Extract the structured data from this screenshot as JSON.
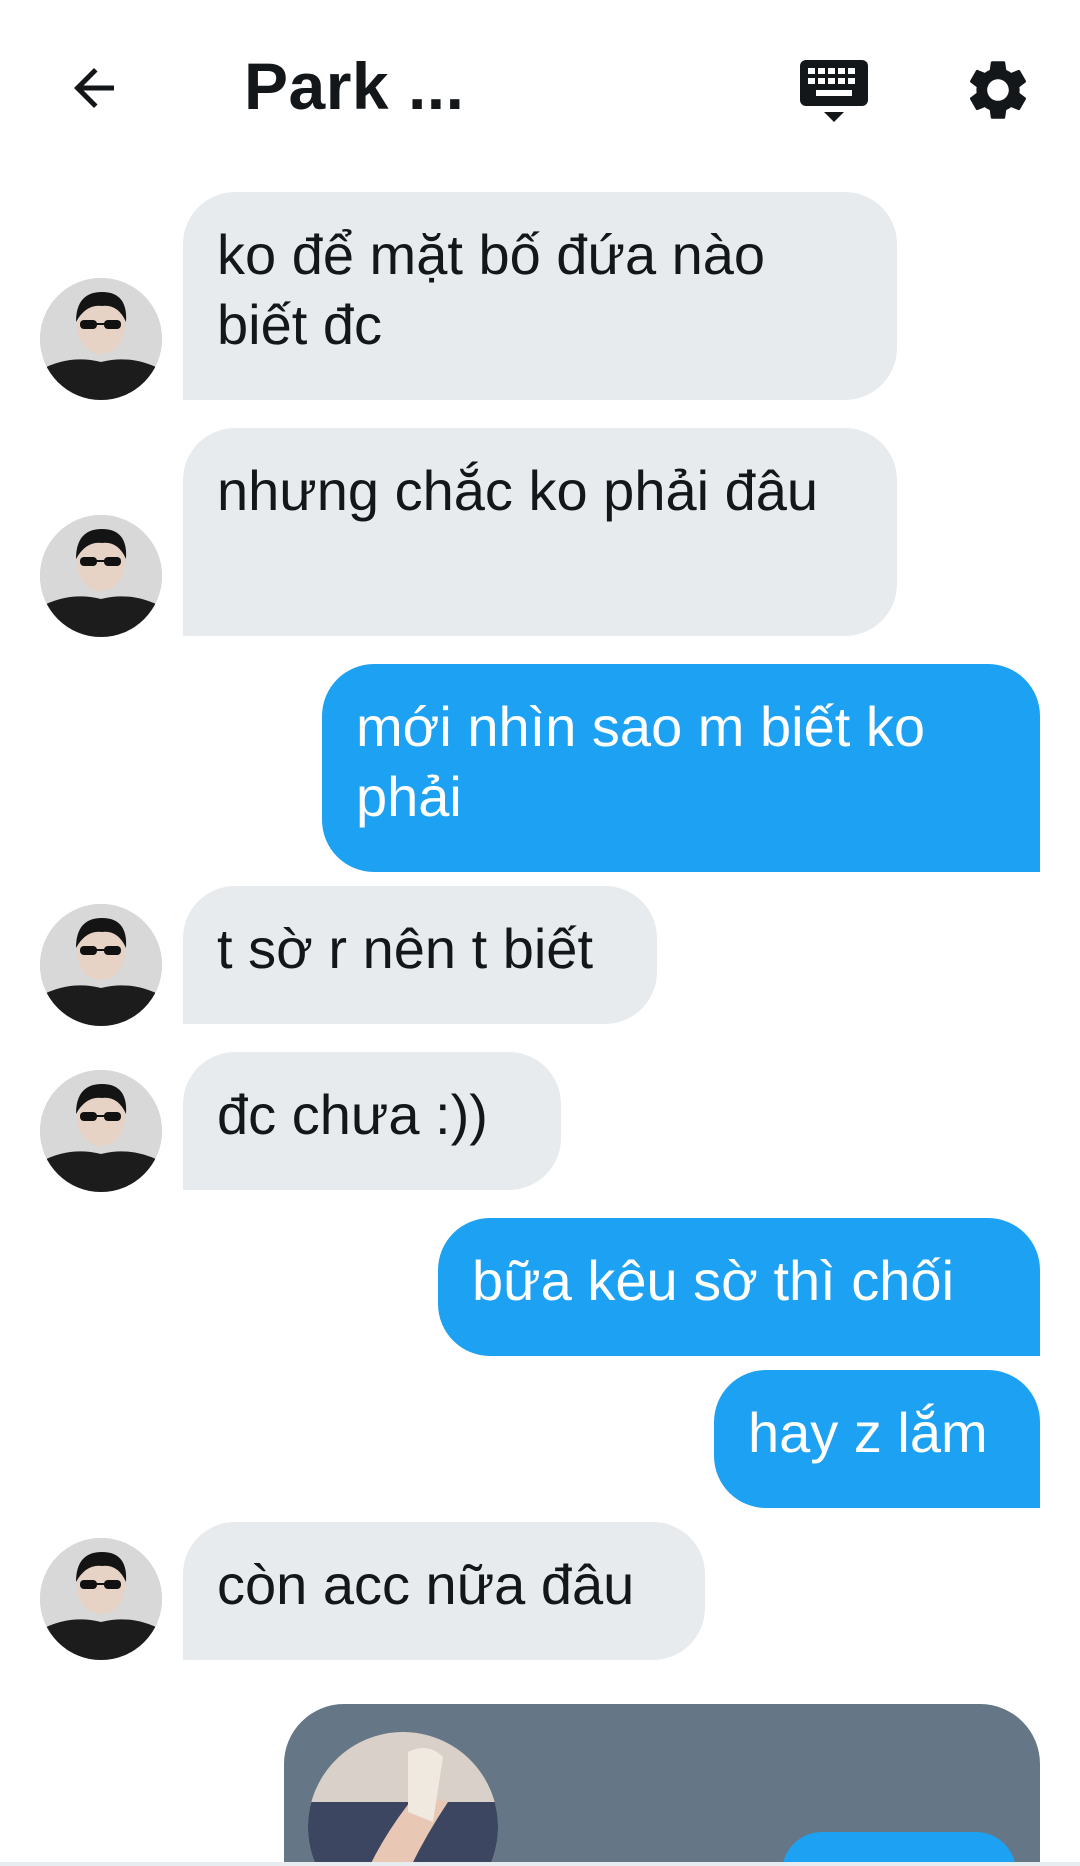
{
  "header": {
    "title": "Park ...",
    "back_icon": "arrow-left-icon",
    "keyboard_icon": "keyboard-icon",
    "settings_icon": "gear-icon"
  },
  "messages": [
    {
      "direction": "incoming",
      "text": "ko để mặt bố đứa nào biết đc"
    },
    {
      "direction": "incoming",
      "text": "nhưng chắc ko phải đâu"
    },
    {
      "direction": "outgoing",
      "text": "mới nhìn sao m biết ko phải"
    },
    {
      "direction": "incoming",
      "text": "t sờ r nên t biết"
    },
    {
      "direction": "incoming",
      "text": "đc chưa :))"
    },
    {
      "direction": "outgoing",
      "text": "bữa kêu sờ thì chối"
    },
    {
      "direction": "outgoing",
      "text": "hay z lắm"
    },
    {
      "direction": "incoming",
      "text": "còn acc nữa đâu"
    }
  ],
  "colors": {
    "incoming_bubble": "#e8ebee",
    "outgoing_bubble": "#1da1f2",
    "media_card": "#657786",
    "text_dark": "#14171a"
  }
}
